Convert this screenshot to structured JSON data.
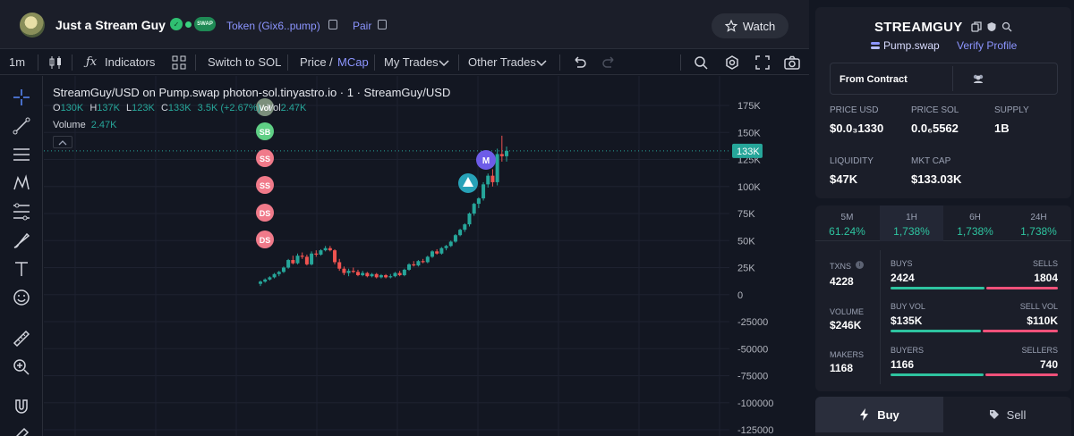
{
  "token": {
    "name": "Just a Stream Guy",
    "swap_badge": "SWAP",
    "token_link": "Token (Gix6..pump)",
    "pair_link": "Pair",
    "watch_label": "Watch"
  },
  "toolbar": {
    "interval": "1m",
    "indicators": "Indicators",
    "switch": "Switch to SOL",
    "price": "Price",
    "slash": "/",
    "mcap": "MCap",
    "my_trades": "My Trades",
    "other_trades": "Other Trades"
  },
  "chart": {
    "title": "StreamGuy/USD on Pump.swap photon-sol.tinyastro.io · 1 · StreamGuy/USD",
    "ohlc": {
      "o_label": "O",
      "o": "130K",
      "h_label": "H",
      "h": "137K",
      "l_label": "L",
      "l": "123K",
      "c_label": "C",
      "c": "133K",
      "change": "3.5K (+2.67%)",
      "vol_label": "Vol",
      "vol": "2.47K"
    },
    "volume_label": "Volume",
    "volume_value": "2.47K",
    "last_price_tag": "133K",
    "markers": [
      "Vol",
      "SB",
      "SS",
      "SS",
      "DS",
      "DS"
    ],
    "m_marker": "M"
  },
  "chart_data": {
    "type": "candlestick",
    "y_ticks": [
      "175K",
      "150K",
      "125K",
      "100K",
      "75K",
      "50K",
      "25K",
      "0",
      "-25000",
      "-50000",
      "-75000",
      "-100000",
      "-125000"
    ],
    "ylim": [
      -125000,
      175000
    ],
    "last_value": 133000,
    "candles": [
      [
        10000,
        13000,
        8000,
        12000
      ],
      [
        12000,
        15000,
        11000,
        14000
      ],
      [
        14000,
        17000,
        13000,
        16000
      ],
      [
        16000,
        20000,
        15000,
        19000
      ],
      [
        19000,
        22000,
        17000,
        21000
      ],
      [
        21000,
        26000,
        20000,
        25000
      ],
      [
        25000,
        33000,
        24000,
        32000
      ],
      [
        32000,
        36000,
        28000,
        29000
      ],
      [
        29000,
        38000,
        28000,
        36000
      ],
      [
        36000,
        39000,
        33000,
        35000
      ],
      [
        35000,
        37000,
        27000,
        28000
      ],
      [
        28000,
        40000,
        27000,
        38000
      ],
      [
        38000,
        41000,
        35000,
        37000
      ],
      [
        37000,
        42000,
        36000,
        41000
      ],
      [
        41000,
        45000,
        40000,
        43000
      ],
      [
        43000,
        45000,
        40000,
        41000
      ],
      [
        41000,
        42000,
        28000,
        30000
      ],
      [
        30000,
        33000,
        22000,
        24000
      ],
      [
        24000,
        26000,
        18000,
        20000
      ],
      [
        20000,
        24000,
        17000,
        22000
      ],
      [
        22000,
        25000,
        20000,
        21000
      ],
      [
        21000,
        23000,
        17000,
        18000
      ],
      [
        18000,
        22000,
        17000,
        20000
      ],
      [
        20000,
        21000,
        16000,
        17000
      ],
      [
        17000,
        20000,
        16000,
        19000
      ],
      [
        19000,
        20000,
        15000,
        16000
      ],
      [
        16000,
        19000,
        15000,
        18000
      ],
      [
        18000,
        19000,
        15000,
        16000
      ],
      [
        16000,
        19000,
        15000,
        17000
      ],
      [
        17000,
        21000,
        16000,
        20000
      ],
      [
        20000,
        22000,
        17000,
        18000
      ],
      [
        18000,
        24000,
        17000,
        23000
      ],
      [
        23000,
        29000,
        22000,
        28000
      ],
      [
        28000,
        31000,
        26000,
        27000
      ],
      [
        27000,
        32000,
        26000,
        31000
      ],
      [
        31000,
        33000,
        29000,
        30000
      ],
      [
        30000,
        36000,
        29000,
        35000
      ],
      [
        35000,
        41000,
        34000,
        40000
      ],
      [
        40000,
        42000,
        37000,
        38000
      ],
      [
        38000,
        44000,
        37000,
        43000
      ],
      [
        43000,
        46000,
        41000,
        45000
      ],
      [
        45000,
        50000,
        44000,
        49000
      ],
      [
        49000,
        56000,
        48000,
        55000
      ],
      [
        55000,
        61000,
        54000,
        60000
      ],
      [
        60000,
        66000,
        58000,
        65000
      ],
      [
        65000,
        76000,
        63000,
        75000
      ],
      [
        75000,
        85000,
        73000,
        84000
      ],
      [
        84000,
        90000,
        80000,
        89000
      ],
      [
        89000,
        104000,
        87000,
        102000
      ],
      [
        102000,
        112000,
        99000,
        110000
      ],
      [
        110000,
        116000,
        100000,
        104000
      ],
      [
        104000,
        135000,
        101000,
        130000
      ],
      [
        130000,
        147000,
        123000,
        128000
      ],
      [
        128000,
        137000,
        123000,
        133000
      ]
    ]
  },
  "panel": {
    "symbol": "STREAMGUY",
    "dex": "Pump.swap",
    "verify": "Verify Profile",
    "from_contract": "From Contract",
    "stats": [
      {
        "label": "PRICE USD",
        "value": "$0.0₃1330"
      },
      {
        "label": "PRICE SOL",
        "value": "0.0₆5562"
      },
      {
        "label": "SUPPLY",
        "value": "1B"
      },
      {
        "label": "LIQUIDITY",
        "value": "$47K"
      },
      {
        "label": "MKT CAP",
        "value": "$133.03K"
      }
    ]
  },
  "timeframes": [
    {
      "label": "5M",
      "value": "61.24%"
    },
    {
      "label": "1H",
      "value": "1,738%"
    },
    {
      "label": "6H",
      "value": "1,738%"
    },
    {
      "label": "24H",
      "value": "1,738%"
    }
  ],
  "txn_stats": {
    "txns_label": "TXNS",
    "txns": "4228",
    "buys_label": "BUYS",
    "buys": "2424",
    "sells_label": "SELLS",
    "sells": "1804",
    "volume_label": "VOLUME",
    "volume": "$246K",
    "buy_vol_label": "BUY VOL",
    "buy_vol": "$135K",
    "sell_vol_label": "SELL VOL",
    "sell_vol": "$110K",
    "makers_label": "MAKERS",
    "makers": "1168",
    "buyers_label": "BUYERS",
    "buyers": "1166",
    "sellers_label": "SELLERS",
    "sellers": "740"
  },
  "trade": {
    "buy": "Buy",
    "sell": "Sell"
  },
  "colors": {
    "up": "#26a69a",
    "down": "#ef5350",
    "accent": "#8c95ff",
    "green": "#2ec4a0",
    "red": "#f0517a"
  }
}
